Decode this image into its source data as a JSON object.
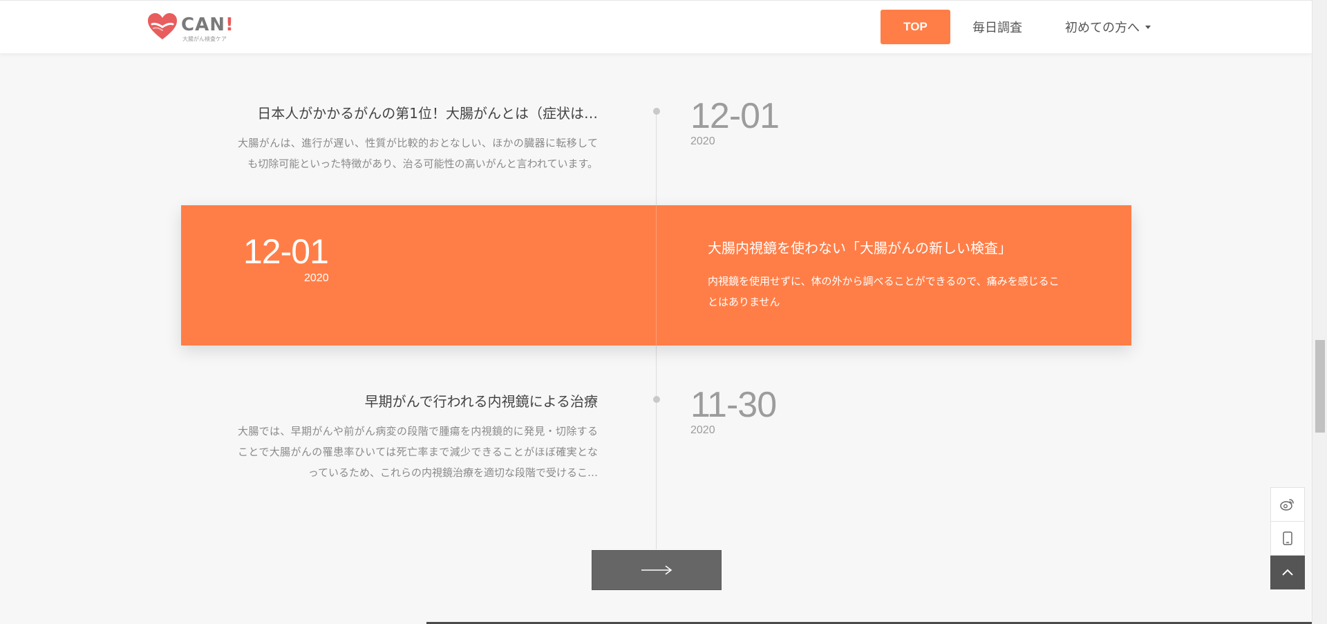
{
  "header": {
    "logo": {
      "brand": "CAN",
      "brand_mark": "!",
      "tagline": "大腸がん検査ケア"
    },
    "nav": {
      "top_label": "TOP",
      "daily_label": "毎日調査",
      "first_label": "初めての方へ"
    }
  },
  "timeline": {
    "items": [
      {
        "title": "日本人がかかるがんの第1位！大腸がんとは（症状は…",
        "desc": "大腸がんは、進行が遅い、性質が比較的おとなしい、ほかの臓器に転移しても切除可能といった特徴があり、治る可能性の高いがんと言われています。",
        "date": "12-01",
        "year": "2020"
      },
      {
        "title": "大腸内視鏡を使わない「大腸がんの新しい検査」",
        "desc": "内視鏡を使用せずに、体の外から調べることができるので、痛みを感じることはありません",
        "date": "12-01",
        "year": "2020"
      },
      {
        "title": "早期がんで行われる内視鏡による治療",
        "desc": "大腸では、早期がんや前がん病変の段階で腫瘍を内視鏡的に発見・切除することで大腸がんの罹患率ひいては死亡率まで減少できることがほぼ確実となっているため、これらの内視鏡治療を適切な段階で受けるこ…",
        "date": "11-30",
        "year": "2020"
      }
    ]
  },
  "colors": {
    "accent": "#ff7e47",
    "dark_button": "#666666"
  },
  "icons": {
    "more": "arrow-right-icon",
    "weibo": "weibo-icon",
    "mobile": "mobile-icon",
    "back_to_top": "chevron-up-icon"
  }
}
